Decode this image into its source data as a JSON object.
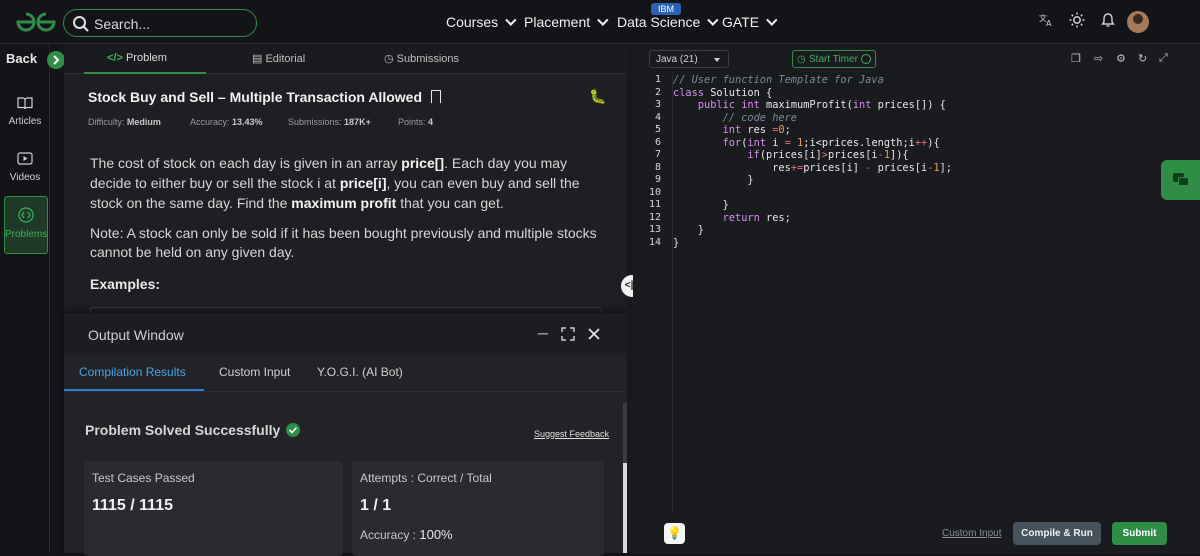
{
  "header": {
    "search_placeholder": "Search...",
    "nav": [
      {
        "label": "Courses"
      },
      {
        "label": "Placement"
      },
      {
        "label": "Data Science",
        "badge": "IBM"
      },
      {
        "label": "GATE"
      }
    ],
    "icons": [
      "translate-icon",
      "theme-toggle-icon",
      "bell-icon",
      "avatar"
    ]
  },
  "sidebar": {
    "back_label": "Back",
    "items": [
      {
        "label": "Articles",
        "icon": "book-icon"
      },
      {
        "label": "Videos",
        "icon": "video-icon"
      },
      {
        "label": "Problems",
        "icon": "code-icon",
        "active": true
      }
    ]
  },
  "problem_tabs": [
    {
      "label": "Problem",
      "icon": "code-icon",
      "active": true
    },
    {
      "label": "Editorial",
      "icon": "document-icon"
    },
    {
      "label": "Submissions",
      "icon": "clock-icon"
    }
  ],
  "problem": {
    "title": "Stock Buy and Sell – Multiple Transaction Allowed",
    "difficulty_label": "Difficulty:",
    "difficulty": "Medium",
    "accuracy_label": "Accuracy:",
    "accuracy": "13.43%",
    "submissions_label": "Submissions:",
    "submissions": "187K+",
    "points_label": "Points:",
    "points": "4",
    "desc_1": "The cost of stock on each day is given in an array ",
    "desc_price": "price[]",
    "desc_2": ". Each day you may decide to either buy or sell the stock i at ",
    "desc_price_i": "price[i]",
    "desc_3": ", you can even buy and sell the stock on the same day. Find the ",
    "desc_max": "maximum profit",
    "desc_4": " that you can get.",
    "note": "Note: A stock can only be sold if it has been bought previously and multiple stocks cannot be held on any given day.",
    "examples": "Examples:"
  },
  "output": {
    "title": "Output Window",
    "tabs": [
      {
        "label": "Compilation Results",
        "active": true
      },
      {
        "label": "Custom Input"
      },
      {
        "label": "Y.O.G.I. (AI Bot)"
      }
    ],
    "status": "Problem Solved Successfully",
    "feedback": "Suggest Feedback",
    "tests_label": "Test Cases Passed",
    "tests_value": "1115 / 1115",
    "attempts_label": "Attempts : Correct / Total",
    "attempts_value": "1 / 1",
    "accuracy_label": "Accuracy :",
    "accuracy_value": "100%"
  },
  "editor": {
    "language": "Java (21)",
    "timer_label": "Start Timer",
    "lines": [
      "1",
      "2",
      "3",
      "4",
      "5",
      "6",
      "7",
      "8",
      "9",
      "10",
      "11",
      "12",
      "13",
      "14"
    ],
    "code": [
      [
        {
          "t": "// User function Template for Java",
          "c": "cm"
        }
      ],
      [
        {
          "t": "class",
          "c": "kw"
        },
        {
          "t": " Solution {",
          "c": ""
        }
      ],
      [
        {
          "t": "    ",
          "c": ""
        },
        {
          "t": "public",
          "c": "kw"
        },
        {
          "t": " ",
          "c": ""
        },
        {
          "t": "int",
          "c": "kw"
        },
        {
          "t": " maximumProfit(",
          "c": ""
        },
        {
          "t": "int",
          "c": "kw"
        },
        {
          "t": " prices[]) {",
          "c": ""
        }
      ],
      [
        {
          "t": "        // code here",
          "c": "cm"
        }
      ],
      [
        {
          "t": "        ",
          "c": ""
        },
        {
          "t": "int",
          "c": "kw"
        },
        {
          "t": " res ",
          "c": ""
        },
        {
          "t": "=",
          "c": "op"
        },
        {
          "t": "0",
          "c": "nm"
        },
        {
          "t": ";",
          "c": ""
        }
      ],
      [
        {
          "t": "        ",
          "c": ""
        },
        {
          "t": "for",
          "c": "kw"
        },
        {
          "t": "(",
          "c": ""
        },
        {
          "t": "int",
          "c": "kw"
        },
        {
          "t": " i ",
          "c": ""
        },
        {
          "t": "=",
          "c": "op"
        },
        {
          "t": " ",
          "c": ""
        },
        {
          "t": "1",
          "c": "nm"
        },
        {
          "t": ";i<prices.length;i",
          "c": ""
        },
        {
          "t": "++",
          "c": "op"
        },
        {
          "t": "){",
          "c": ""
        }
      ],
      [
        {
          "t": "            ",
          "c": ""
        },
        {
          "t": "if",
          "c": "kw"
        },
        {
          "t": "(prices[i]",
          "c": ""
        },
        {
          "t": ">",
          "c": "op"
        },
        {
          "t": "prices[i",
          "c": ""
        },
        {
          "t": "-",
          "c": "op"
        },
        {
          "t": "1",
          "c": "nm"
        },
        {
          "t": "]){",
          "c": ""
        }
      ],
      [
        {
          "t": "                res",
          "c": ""
        },
        {
          "t": "+=",
          "c": "op"
        },
        {
          "t": "prices[i] ",
          "c": ""
        },
        {
          "t": "-",
          "c": "op"
        },
        {
          "t": " prices[i",
          "c": ""
        },
        {
          "t": "-",
          "c": "op"
        },
        {
          "t": "1",
          "c": "nm"
        },
        {
          "t": "];",
          "c": ""
        }
      ],
      [
        {
          "t": "            }",
          "c": ""
        }
      ],
      [
        {
          "t": "",
          "c": ""
        }
      ],
      [
        {
          "t": "        }",
          "c": ""
        }
      ],
      [
        {
          "t": "        ",
          "c": ""
        },
        {
          "t": "return",
          "c": "kw"
        },
        {
          "t": " res;",
          "c": ""
        }
      ],
      [
        {
          "t": "    }",
          "c": ""
        }
      ],
      [
        {
          "t": "}",
          "c": ""
        }
      ]
    ],
    "custom_input": "Custom Input",
    "compile_label": "Compile & Run",
    "submit_label": "Submit"
  }
}
